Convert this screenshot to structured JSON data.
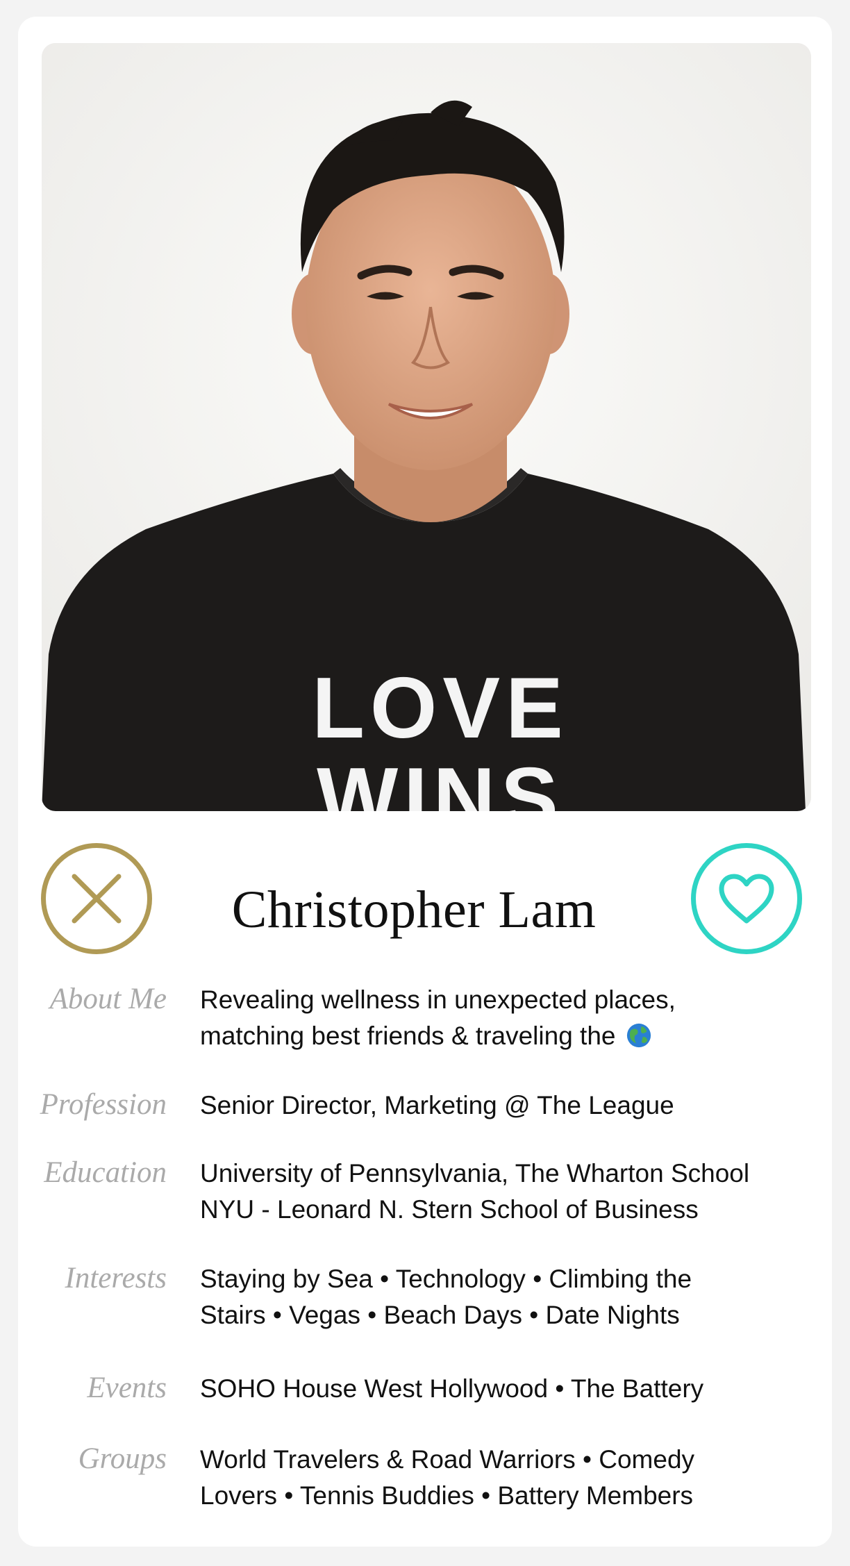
{
  "profile": {
    "name": "Christopher Lam",
    "shirt_text": [
      "LOVE",
      "WINS"
    ],
    "about": {
      "label": "About Me",
      "value": "Revealing wellness in unexpected places,\nmatching best friends & traveling the ",
      "emoji": "globe-icon"
    },
    "profession": {
      "label": "Profession",
      "value": "Senior Director, Marketing @ The League"
    },
    "education": {
      "label": "Education",
      "value": "University of Pennsylvania, The Wharton School\nNYU - Leonard N. Stern School of Business"
    },
    "interests": {
      "label": "Interests",
      "value": "Staying by Sea • Technology • Climbing the\nStairs • Vegas • Beach Days • Date Nights"
    },
    "events": {
      "label": "Events",
      "value": "SOHO House West Hollywood • The Battery"
    },
    "groups": {
      "label": "Groups",
      "value": "World Travelers & Road Warriors • Comedy\nLovers • Tennis Buddies • Battery Members"
    }
  },
  "actions": {
    "pass_icon": "close-icon",
    "like_icon": "heart-icon"
  },
  "colors": {
    "pass": "#b09a55",
    "like": "#2ed4c4",
    "label": "#aaaaaa",
    "background": "#f3f3f3"
  }
}
